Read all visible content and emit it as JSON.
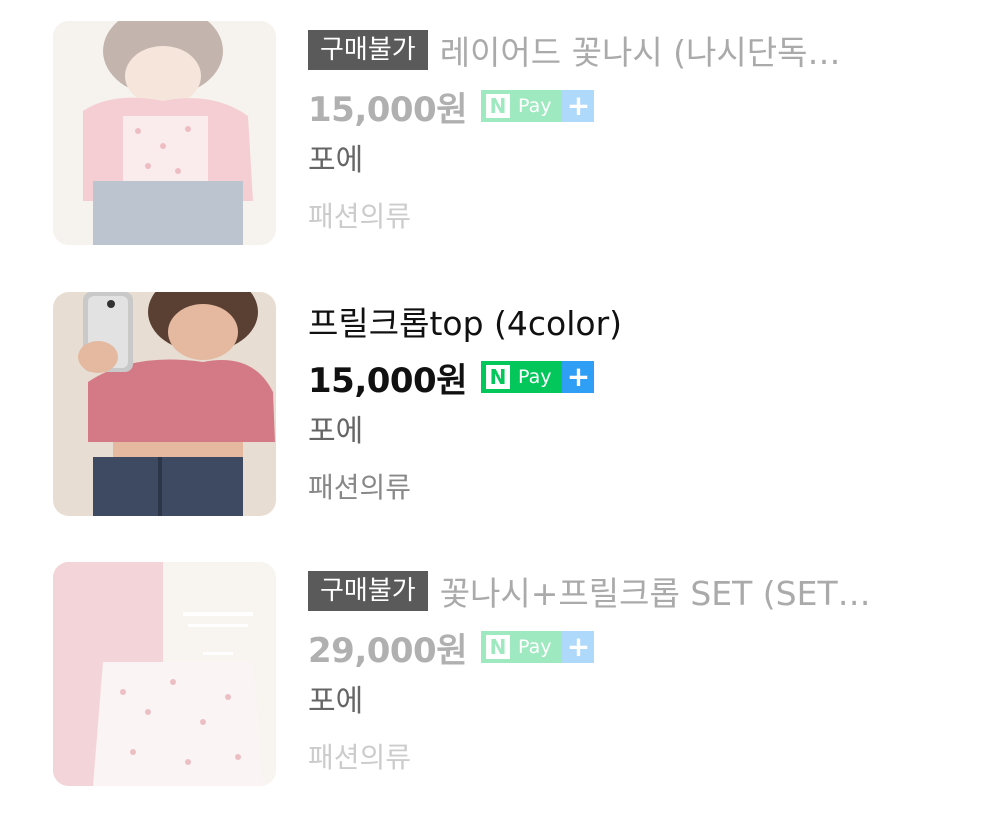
{
  "products": [
    {
      "badge": "구매불가",
      "title": "레이어드 꽃나시 (나시단독…",
      "price": "15,000원",
      "npay_n": "N",
      "npay_label": "Pay",
      "npay_plus": "+",
      "seller": "포에",
      "category": "패션의류"
    },
    {
      "title": "프릴크롭top (4color)",
      "price": "15,000원",
      "npay_n": "N",
      "npay_label": "Pay",
      "npay_plus": "+",
      "seller": "포에",
      "category": "패션의류"
    },
    {
      "badge": "구매불가",
      "title": "꽃나시+프릴크롭 SET (SET…",
      "price": "29,000원",
      "npay_n": "N",
      "npay_label": "Pay",
      "npay_plus": "+",
      "seller": "포에",
      "category": "패션의류"
    }
  ],
  "colors": {
    "npay_green": "#03c75a",
    "npay_blue": "#2f9ef5",
    "badge_bg": "#5a5a5a"
  }
}
